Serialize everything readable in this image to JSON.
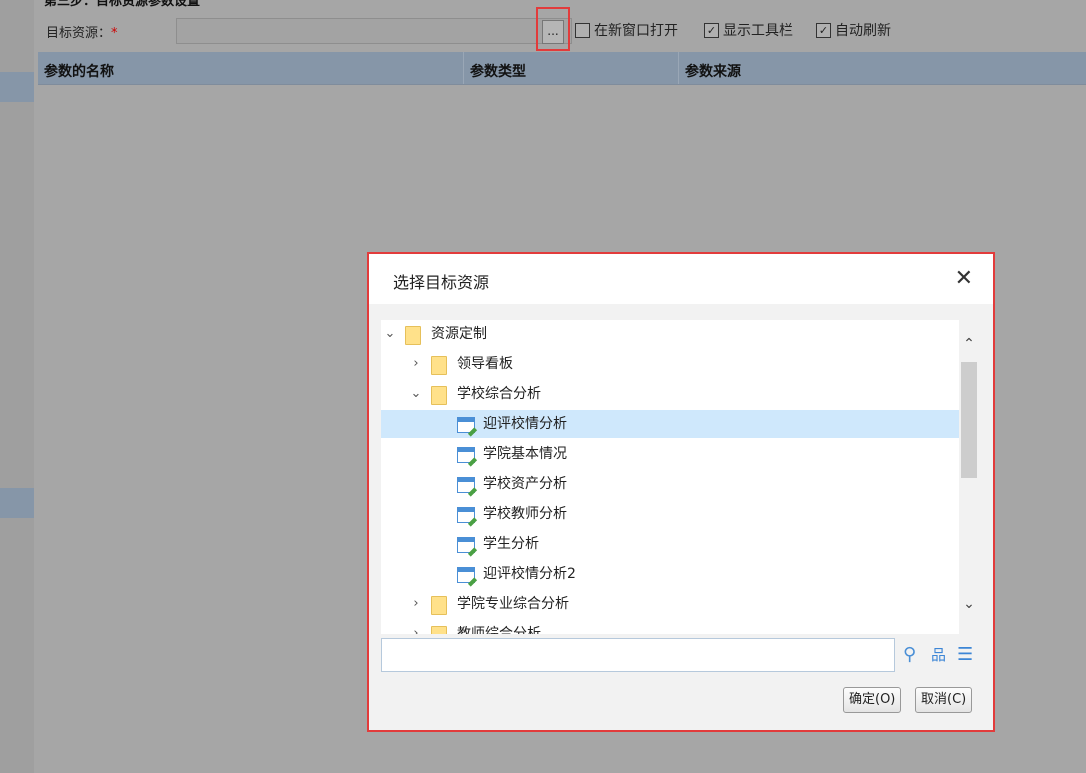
{
  "page": {
    "step_title": "第三步：目标资源参数设置",
    "target_label": "目标资源：",
    "required_mark": "*",
    "target_value": "",
    "browse_label": "...",
    "options": [
      {
        "label": "在新窗口打开",
        "checked": false
      },
      {
        "label": "显示工具栏",
        "checked": true
      },
      {
        "label": "自动刷新",
        "checked": true
      }
    ],
    "grid_columns": [
      "参数的名称",
      "参数类型",
      "参数来源"
    ]
  },
  "dialog": {
    "title": "选择目标资源",
    "close_glyph": "✕",
    "tree": [
      {
        "label": "资源定制",
        "type": "folder",
        "level": 0,
        "expanded": true
      },
      {
        "label": "领导看板",
        "type": "folder",
        "level": 1,
        "expanded": false
      },
      {
        "label": "学校综合分析",
        "type": "folder",
        "level": 1,
        "expanded": true
      },
      {
        "label": "迎评校情分析",
        "type": "report",
        "level": 2,
        "selected": true
      },
      {
        "label": "学院基本情况",
        "type": "report",
        "level": 2
      },
      {
        "label": "学校资产分析",
        "type": "report",
        "level": 2
      },
      {
        "label": "学校教师分析",
        "type": "report",
        "level": 2
      },
      {
        "label": "学生分析",
        "type": "report",
        "level": 2
      },
      {
        "label": "迎评校情分析2",
        "type": "report",
        "level": 2
      },
      {
        "label": "学院专业综合分析",
        "type": "folder",
        "level": 1,
        "expanded": false
      },
      {
        "label": "教师综合分析",
        "type": "folder",
        "level": 1,
        "expanded": false
      }
    ],
    "search_value": "",
    "icons": [
      "search-icon",
      "tree-view-icon",
      "list-view-icon"
    ],
    "ok_label": "确定(O)",
    "cancel_label": "取消(C)"
  },
  "colors": {
    "accent": "#e23b3b",
    "header_bg": "#8696a8",
    "selected_row": "#cfe8fc"
  }
}
